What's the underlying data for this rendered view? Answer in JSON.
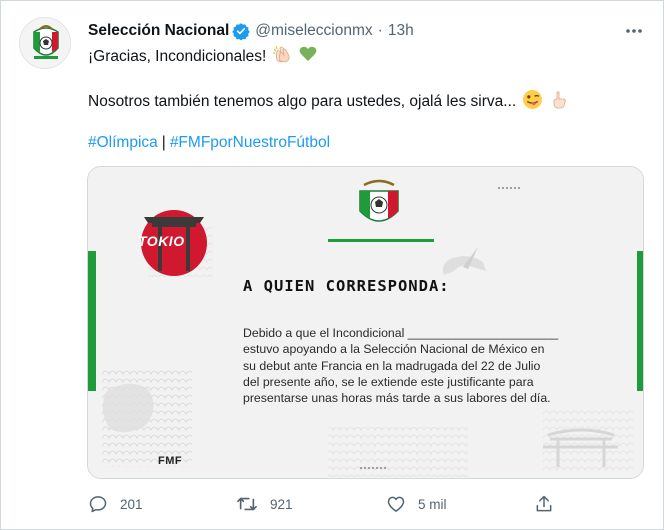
{
  "tweet": {
    "display_name": "Selección Nacional",
    "handle": "@miseleccionmx",
    "separator": "·",
    "time": "13h",
    "line1": "¡Gracias, Incondicionales!",
    "line2": "Nosotros también tenemos algo para ustedes, ojalá les sirva...",
    "hashtags": [
      "#Olímpica",
      "#FMFporNuestroFútbol"
    ],
    "hashtag_separator": "|"
  },
  "image": {
    "tokio_label": "TOKIO",
    "title": "A QUIEN CORRESPONDA:",
    "body_lines": [
      "Debido a que el Incondicional  ______________________",
      "estuvo apoyando a la Selección Nacional de México en",
      "su debut ante Francia en la madrugada del 22 de Julio",
      "del presente año, se le extiende este justificante para",
      "presentarse unas horas más tarde a sus labores del día."
    ],
    "footer_logo": "FMF"
  },
  "actions": {
    "replies": "201",
    "retweets": "921",
    "likes": "5 mil"
  },
  "colors": {
    "link": "#1d9bf0",
    "muted": "#536471",
    "green": "#1f9b3b",
    "red": "#d0182f"
  },
  "icons": [
    "verified-badge-icon",
    "more-icon",
    "clapping-hands-emoji",
    "green-heart-emoji",
    "winking-tongue-emoji",
    "pointing-hand-emoji",
    "reply-icon",
    "retweet-icon",
    "like-icon",
    "share-icon",
    "crest-icon"
  ]
}
